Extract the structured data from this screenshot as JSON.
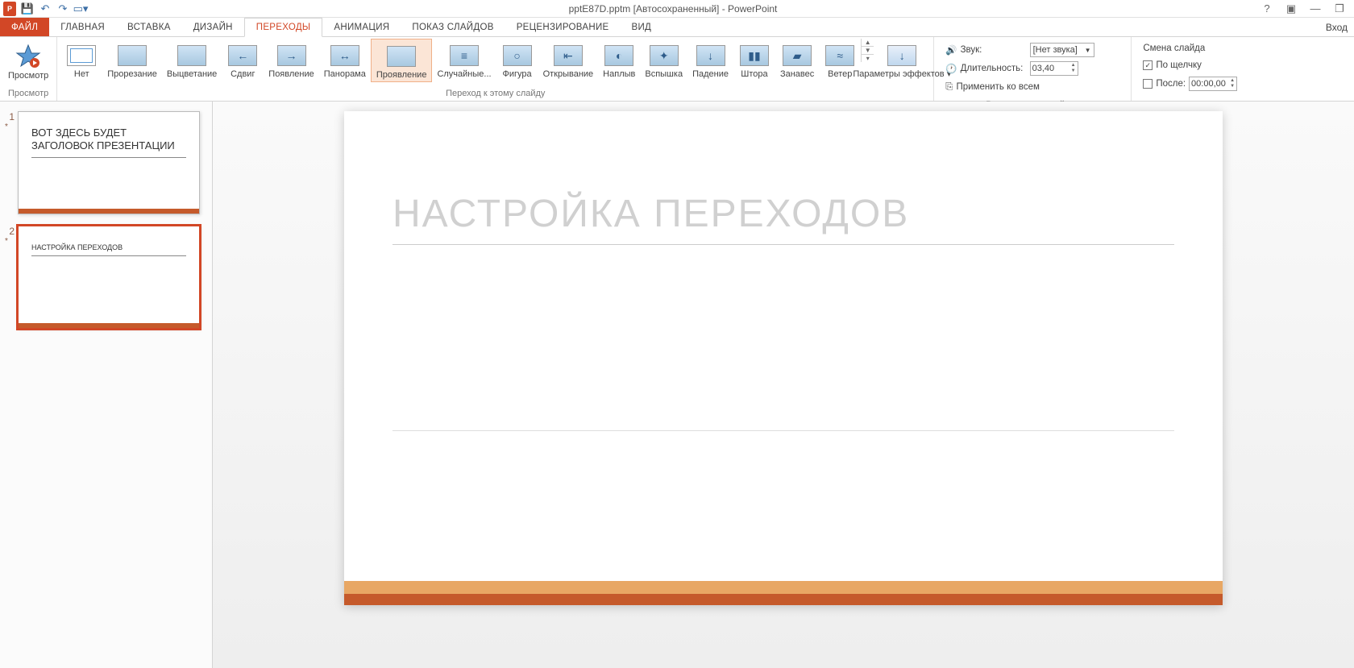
{
  "titlebar": {
    "title": "pptE87D.pptm [Автосохраненный] - PowerPoint"
  },
  "tabs": {
    "file": "ФАЙЛ",
    "items": [
      "ГЛАВНАЯ",
      "ВСТАВКА",
      "ДИЗАЙН",
      "ПЕРЕХОДЫ",
      "АНИМАЦИЯ",
      "ПОКАЗ СЛАЙДОВ",
      "РЕЦЕНЗИРОВАНИЕ",
      "ВИД"
    ],
    "active_index": 3,
    "signin": "Вход"
  },
  "ribbon": {
    "preview": {
      "label": "Просмотр",
      "group": "Просмотр"
    },
    "transitions": {
      "items": [
        "Нет",
        "Прорезание",
        "Выцветание",
        "Сдвиг",
        "Появление",
        "Панорама",
        "Проявление",
        "Случайные...",
        "Фигура",
        "Открывание",
        "Наплыв",
        "Вспышка",
        "Падение",
        "Штора",
        "Занавес",
        "Ветер"
      ],
      "selected_index": 6,
      "effect_options": "Параметры эффектов",
      "group": "Переход к этому слайду"
    },
    "timing": {
      "sound_label": "Звук:",
      "sound_value": "[Нет звука]",
      "duration_label": "Длительность:",
      "duration_value": "03,40",
      "apply_all": "Применить ко всем",
      "advance_label": "Смена слайда",
      "on_click": "По щелчку",
      "on_click_checked": true,
      "after": "После:",
      "after_checked": false,
      "after_value": "00:00,00",
      "group": "Время показа слайдов"
    }
  },
  "slides": {
    "thumbs": [
      {
        "num": "1",
        "title": "ВОТ ЗДЕСЬ БУДЕТ ЗАГОЛОВОК ПРЕЗЕНТАЦИИ"
      },
      {
        "num": "2",
        "title": "НАСТРОЙКА ПЕРЕХОДОВ"
      }
    ],
    "active_index": 1,
    "canvas_title": "НАСТРОЙКА ПЕРЕХОДОВ"
  }
}
